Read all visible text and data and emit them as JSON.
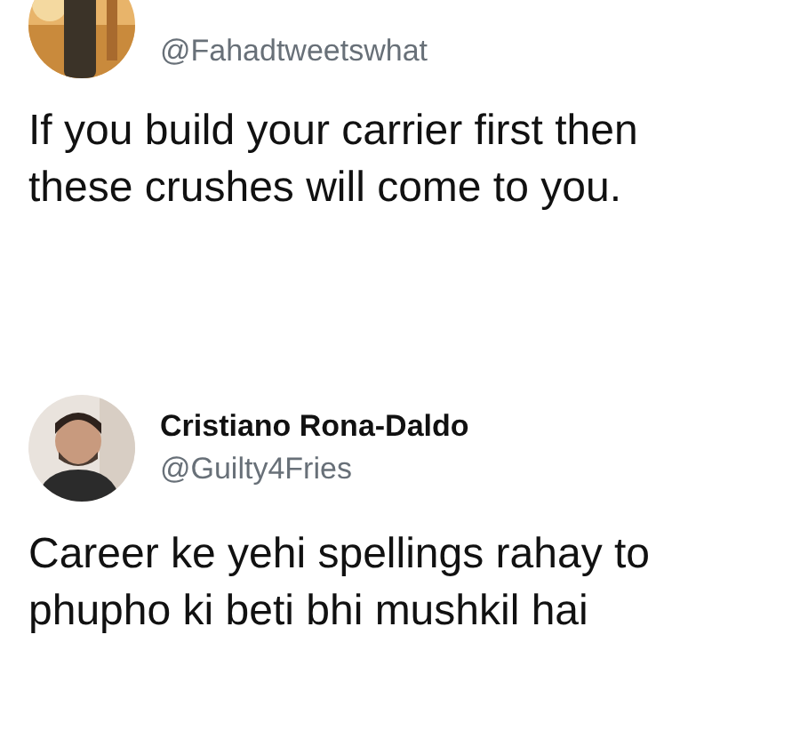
{
  "tweets": [
    {
      "handle": "@Fahadtweetswhat",
      "text": "If you build your carrier first then these crushes will come to you."
    },
    {
      "name": "Cristiano Rona-Daldo",
      "handle": "@Guilty4Fries",
      "text": "Career ke yehi spellings rahay to phupho ki beti bhi mushkil hai"
    }
  ]
}
